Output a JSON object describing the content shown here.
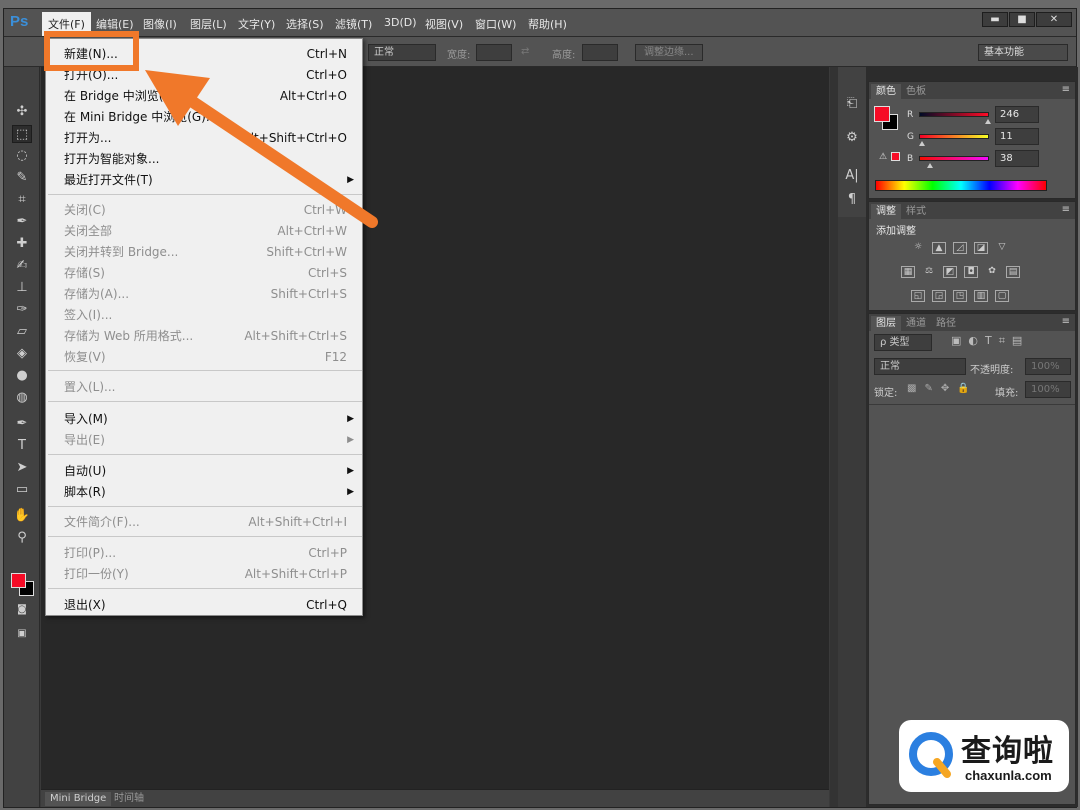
{
  "app": {
    "logo": "Ps"
  },
  "menubar": {
    "items": [
      "文件(F)",
      "编辑(E)",
      "图像(I)",
      "图层(L)",
      "文字(Y)",
      "选择(S)",
      "滤镜(T)",
      "3D(D)",
      "视图(V)",
      "窗口(W)",
      "帮助(H)"
    ],
    "window_buttons": {
      "minimize": "▬",
      "maximize": "■",
      "close": "✕"
    }
  },
  "options": {
    "mode_value": "正常",
    "width_label": "宽度:",
    "height_label": "高度:",
    "refine_edge_label": "调整边缘...",
    "workspace_value": "基本功能"
  },
  "file_menu": {
    "items": [
      {
        "label": "新建(N)...",
        "shortcut": "Ctrl+N"
      },
      {
        "label": "打开(O)...",
        "shortcut": "Ctrl+O"
      },
      {
        "label": "在 Bridge 中浏览(B)...",
        "shortcut": "Alt+Ctrl+O"
      },
      {
        "label": "在 Mini Bridge 中浏览(G)...",
        "shortcut": ""
      },
      {
        "label": "打开为...",
        "shortcut": "Alt+Shift+Ctrl+O"
      },
      {
        "label": "打开为智能对象...",
        "shortcut": ""
      },
      {
        "label": "最近打开文件(T)",
        "shortcut": ""
      },
      {
        "label": "关闭(C)",
        "shortcut": "Ctrl+W"
      },
      {
        "label": "关闭全部",
        "shortcut": "Alt+Ctrl+W"
      },
      {
        "label": "关闭并转到 Bridge...",
        "shortcut": "Shift+Ctrl+W"
      },
      {
        "label": "存储(S)",
        "shortcut": "Ctrl+S"
      },
      {
        "label": "存储为(A)...",
        "shortcut": "Shift+Ctrl+S"
      },
      {
        "label": "签入(I)...",
        "shortcut": ""
      },
      {
        "label": "存储为 Web 所用格式...",
        "shortcut": "Alt+Shift+Ctrl+S"
      },
      {
        "label": "恢复(V)",
        "shortcut": "F12"
      },
      {
        "label": "置入(L)...",
        "shortcut": ""
      },
      {
        "label": "导入(M)",
        "shortcut": ""
      },
      {
        "label": "导出(E)",
        "shortcut": ""
      },
      {
        "label": "自动(U)",
        "shortcut": ""
      },
      {
        "label": "脚本(R)",
        "shortcut": ""
      },
      {
        "label": "文件简介(F)...",
        "shortcut": "Alt+Shift+Ctrl+I"
      },
      {
        "label": "打印(P)...",
        "shortcut": "Ctrl+P"
      },
      {
        "label": "打印一份(Y)",
        "shortcut": "Alt+Shift+Ctrl+P"
      },
      {
        "label": "退出(X)",
        "shortcut": "Ctrl+Q"
      }
    ],
    "submenu_arrow": "▶"
  },
  "color_panel": {
    "tabs": [
      "颜色",
      "色板"
    ],
    "r_label": "R",
    "g_label": "G",
    "b_label": "B",
    "r_value": "246",
    "g_value": "11",
    "b_value": "38",
    "foreground_color": "#f60b26",
    "background_color": "#000000"
  },
  "adjustments_panel": {
    "tabs": [
      "调整",
      "样式"
    ],
    "title": "添加调整"
  },
  "layers_panel": {
    "tabs": [
      "图层",
      "通道",
      "路径"
    ],
    "filter_label": "ρ 类型",
    "blend_mode": "正常",
    "opacity_label": "不透明度:",
    "opacity_value": "100%",
    "lock_label": "锁定:",
    "fill_label": "填充:",
    "fill_value": "100%"
  },
  "bottom_tabs": [
    "Mini Bridge",
    "时间轴"
  ],
  "annotation": {
    "highlight_color": "#f0782a"
  },
  "watermark": {
    "title": "查询啦",
    "domain": "chaxunla.com"
  }
}
